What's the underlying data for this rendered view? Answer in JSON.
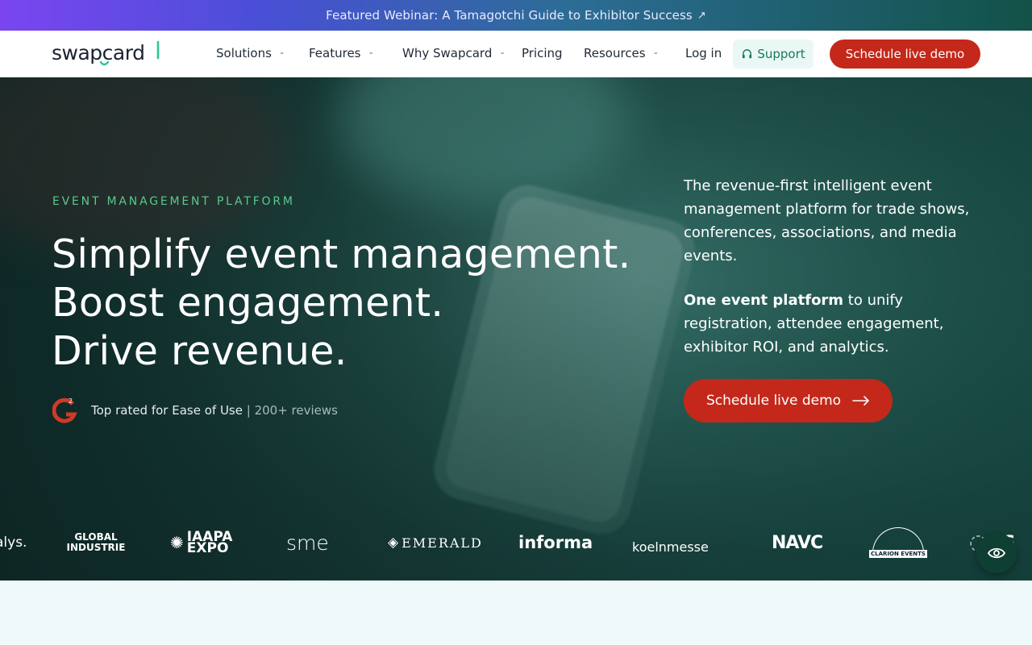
{
  "banner": {
    "text": "Featured Webinar: A Tamagotchi Guide to Exhibitor Success",
    "arrow": "↗"
  },
  "nav": {
    "logo": "swapcard",
    "items": [
      {
        "label": "Solutions",
        "dropdown": true
      },
      {
        "label": "Features",
        "dropdown": true
      },
      {
        "label": "Why Swapcard",
        "dropdown": true
      },
      {
        "label": "Pricing",
        "dropdown": false
      },
      {
        "label": "Resources",
        "dropdown": true
      }
    ],
    "login": "Log in",
    "support": "Support",
    "cta": "Schedule live demo"
  },
  "hero": {
    "eyebrow": "EVENT MANAGEMENT PLATFORM",
    "headline": [
      "Simplify event management.",
      "Boost engagement.",
      "Drive revenue."
    ],
    "rating_badge": "G2",
    "rating_strong": "Top rated for Ease of Use",
    "rating_sep": "|",
    "rating_muted": "200+ reviews",
    "desc1": "The revenue-first intelligent event management platform for trade shows, conferences, associations, and media events.",
    "desc2_bold": "One event platform",
    "desc2_rest": " to unify registration, attendee engagement, exhibitor ROI, and analytics.",
    "cta": "Schedule live demo"
  },
  "logos": [
    "alys.",
    "GLOBAL INDUSTRIE",
    "IAAPA EXPO",
    "sme",
    "EMERALD",
    "informa",
    "koelnmesse",
    "NAVC",
    "CLARION EVENTS",
    "ES"
  ],
  "colors": {
    "accent": "#c4281a",
    "eyebrow": "#59c98f",
    "support_bg": "#eaf8f5",
    "support_text": "#16795f"
  },
  "icons": {
    "support": "headset-icon",
    "fab": "eye-icon",
    "arrow": "arrow-right-icon"
  }
}
